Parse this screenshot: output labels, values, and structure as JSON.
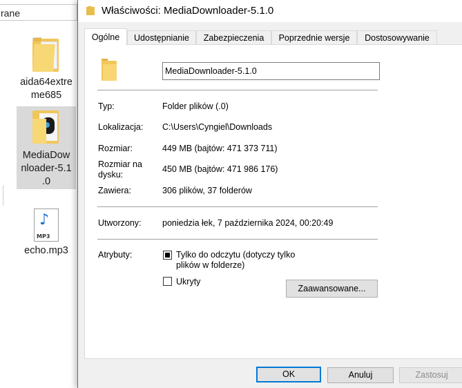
{
  "explorer": {
    "address_fragment": "rane",
    "items": [
      {
        "label": "aida64extreme685"
      },
      {
        "label": "MediaDownloader-5.1.0"
      },
      {
        "label": "echo.mp3",
        "badge": "MP3"
      }
    ],
    "label_lines": {
      "aida_1": "aida64extre",
      "aida_2": "me685",
      "md_1": "MediaDow",
      "md_2": "nloader-5.1",
      "md_3": ".0",
      "echo_1": "echo.mp3"
    }
  },
  "dialog": {
    "title": "Właściwości: MediaDownloader-5.1.0",
    "tabs": [
      "Ogólne",
      "Udostępnianie",
      "Zabezpieczenia",
      "Poprzednie wersje",
      "Dostosowywanie"
    ],
    "active_tab": "Ogólne",
    "name_value": "MediaDownloader-5.1.0",
    "props": {
      "type_label": "Typ:",
      "type_value": "Folder plików (.0)",
      "location_label": "Lokalizacja:",
      "location_value": "C:\\Users\\Cyngiel\\Downloads",
      "size_label": "Rozmiar:",
      "size_value": "449 MB (bajtów: 471 373 711)",
      "disk_label_1": "Rozmiar na",
      "disk_label_2": "dysku:",
      "disk_value": "450 MB (bajtów: 471 986 176)",
      "contains_label": "Zawiera:",
      "contains_value": "306 plików, 37 folderów",
      "created_label": "Utworzony:",
      "created_value": "poniedzia łek, 7 października 2024, 00:20:49",
      "attributes_label": "Atrybuty:"
    },
    "attributes": {
      "readonly_line_1": "Tylko do odczytu (dotyczy tylko",
      "readonly_line_2": "plików w folderze)",
      "readonly_state": "indeterminate",
      "hidden_label": "Ukryty",
      "hidden_state": "unchecked",
      "advanced_button": "Zaawansowane..."
    },
    "buttons": {
      "ok": "OK",
      "cancel": "Anuluj",
      "apply": "Zastosuj"
    }
  },
  "colors": {
    "selection_bg": "#d9d9d9",
    "default_button_border": "#0078d7",
    "folder_yellow": "#f8d775"
  }
}
